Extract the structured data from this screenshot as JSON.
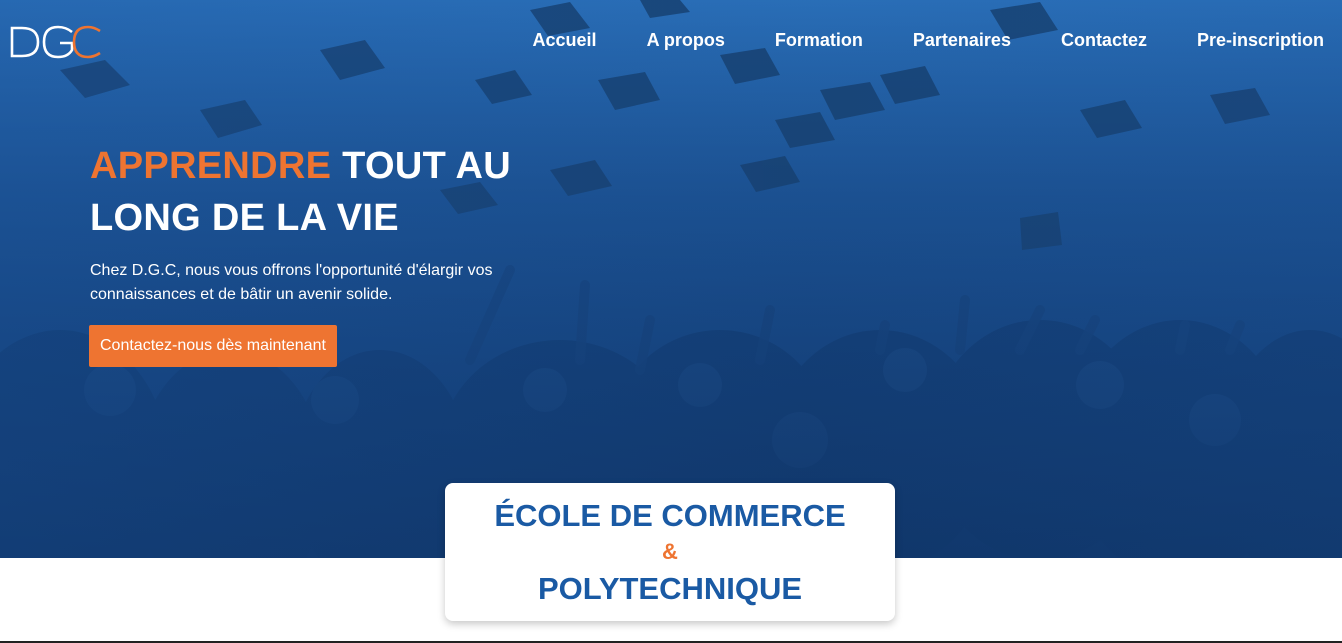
{
  "brand": {
    "logo_text": "DGC",
    "logo_colors": {
      "d": "#ffffff",
      "g": "#ffffff",
      "c": "#ee7431"
    }
  },
  "nav": {
    "items": [
      {
        "label": "Accueil"
      },
      {
        "label": "A propos"
      },
      {
        "label": "Formation"
      },
      {
        "label": "Partenaires"
      },
      {
        "label": "Contactez"
      },
      {
        "label": "Pre-inscription"
      }
    ]
  },
  "hero": {
    "headline_accent": "APPRENDRE",
    "headline_rest": " TOUT AU LONG DE LA VIE",
    "subtext": "Chez D.G.C, nous vous offrons l'opportunité d'élargir vos connaissances et de bâtir un avenir solide.",
    "cta_label": "Contactez-nous dès maintenant",
    "background_image": "graduates-throwing-caps"
  },
  "card": {
    "line1": "ÉCOLE DE COMMERCE",
    "amp": "&",
    "line2": "POLYTECHNIQUE"
  },
  "colors": {
    "primary_blue": "#1a5aa4",
    "accent_orange": "#ee7431",
    "hero_blue": "#2465ad"
  }
}
